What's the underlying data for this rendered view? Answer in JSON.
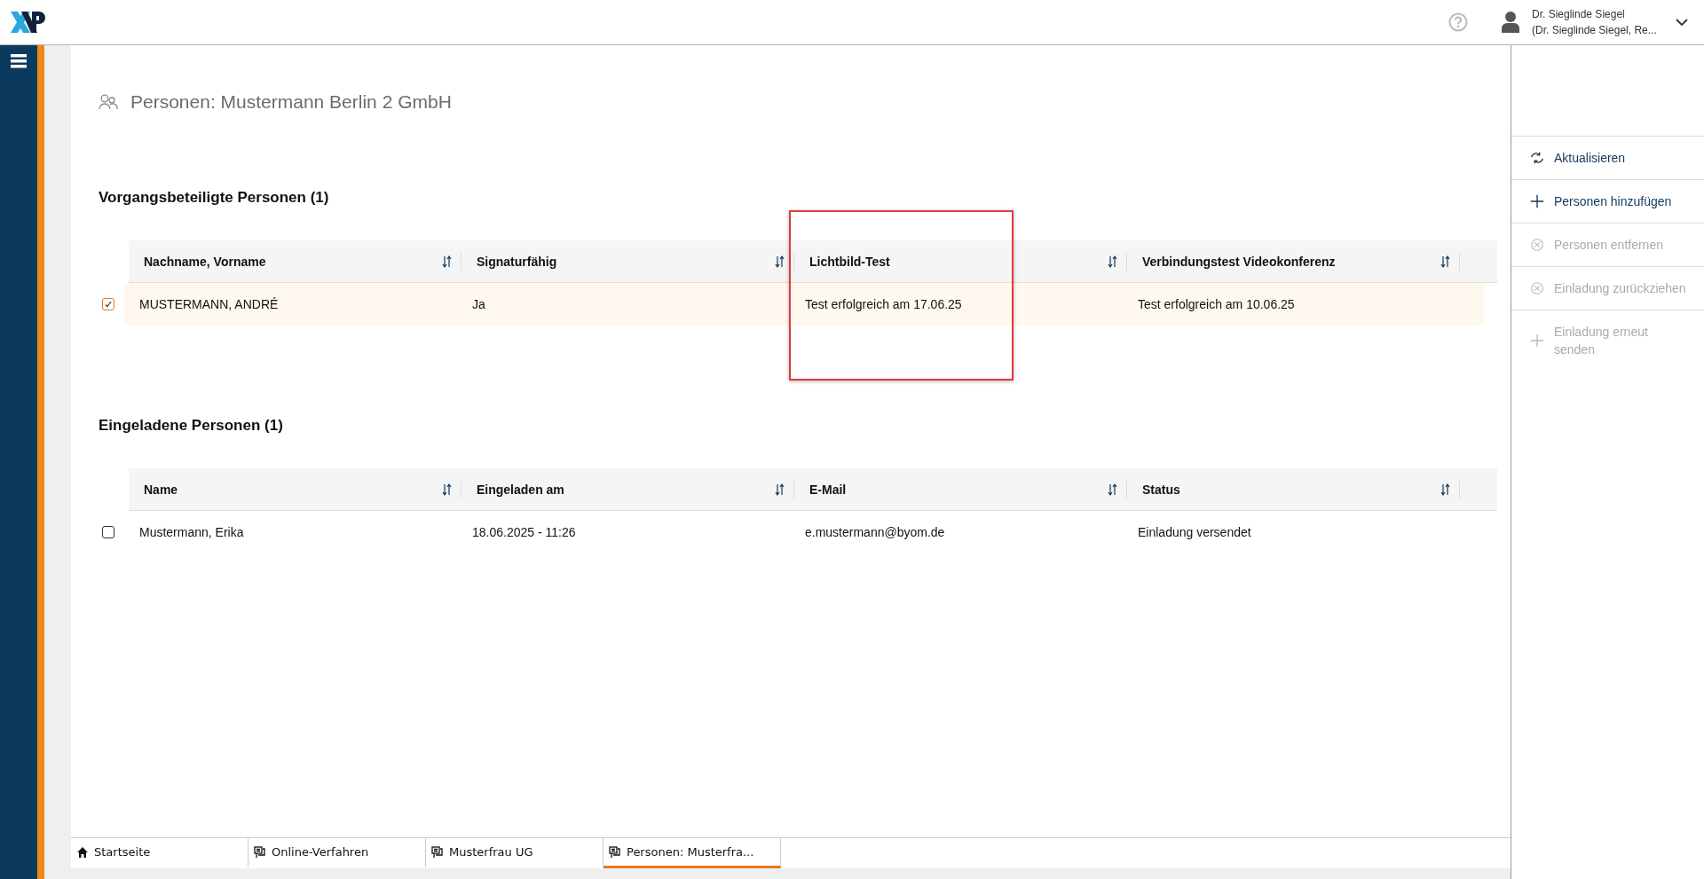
{
  "header": {
    "user_name": "Dr. Sieglinde Siegel",
    "user_role": "(Dr. Sieglinde Siegel, Re..."
  },
  "page_title": "Personen: Mustermann Berlin 2 GmbH",
  "sections": [
    {
      "title": "Vorgangsbeteiligte Personen (1)",
      "columns": [
        "Nachname, Vorname",
        "Signaturfähig",
        "Lichtbild-Test",
        "Verbindungstest Videokonferenz"
      ],
      "highlighted_columns": [
        false,
        false,
        true,
        false
      ],
      "rows": [
        {
          "selected": true,
          "cells": [
            "MUSTERMANN, ANDRÉ",
            "Ja",
            "Test erfolgreich am 17.06.25",
            "Test erfolgreich am 10.06.25"
          ]
        }
      ]
    },
    {
      "title": "Eingeladene Personen (1)",
      "columns": [
        "Name",
        "Eingeladen am",
        "E-Mail",
        "Status"
      ],
      "rows": [
        {
          "selected": false,
          "cells": [
            "Mustermann, Erika",
            "18.06.2025 - 11:26",
            "e.mustermann@byom.de",
            "Einladung versendet"
          ]
        }
      ]
    }
  ],
  "actions": [
    {
      "kind": "refresh",
      "label": "Aktualisieren",
      "disabled": false
    },
    {
      "kind": "add",
      "label": "Personen hinzufügen",
      "disabled": false
    },
    {
      "kind": "remove",
      "label": "Personen entfernen",
      "disabled": true
    },
    {
      "kind": "remove",
      "label": "Einladung zurückziehen",
      "disabled": true
    },
    {
      "kind": "add",
      "label": "Einladung erneut senden",
      "disabled": true
    }
  ],
  "tabs": [
    {
      "kind": "home",
      "label": "Startseite",
      "selected": false
    },
    {
      "kind": "document",
      "label": "Online-Verfahren",
      "selected": false
    },
    {
      "kind": "document",
      "label": "Musterfrau UG",
      "selected": false
    },
    {
      "kind": "document",
      "label": "Personen: Musterfra...",
      "selected": true
    }
  ]
}
